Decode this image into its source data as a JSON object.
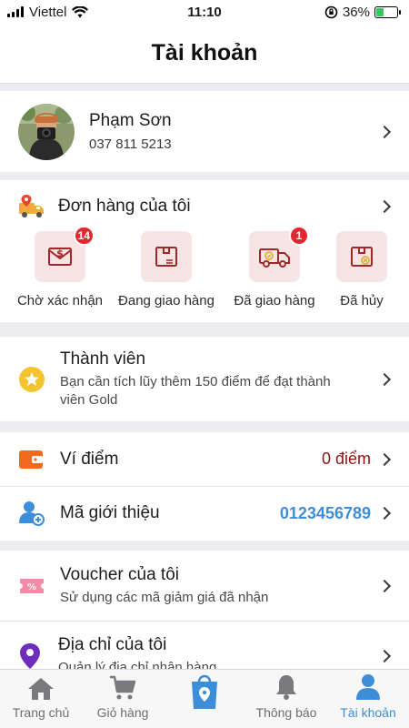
{
  "status_bar": {
    "carrier": "Viettel",
    "time": "11:10",
    "battery": "36%"
  },
  "header": {
    "title": "Tài khoản"
  },
  "profile": {
    "name": "Phạm Sơn",
    "phone": "037 811 5213"
  },
  "orders": {
    "title": "Đơn hàng của tôi",
    "items": [
      {
        "label": "Chờ xác nhận",
        "badge": "14",
        "icon": "envelope-money-icon"
      },
      {
        "label": "Đang giao hàng",
        "badge": "",
        "icon": "package-icon"
      },
      {
        "label": "Đã giao hàng",
        "badge": "1",
        "icon": "delivery-truck-icon"
      },
      {
        "label": "Đã hủy",
        "badge": "",
        "icon": "cancelled-box-icon"
      }
    ]
  },
  "membership": {
    "title": "Thành viên",
    "description": "Bạn cần tích lũy thêm 150 điểm để đạt thành viên Gold"
  },
  "wallet": {
    "title": "Ví điểm",
    "value": "0 điểm"
  },
  "referral": {
    "title": "Mã giới thiệu",
    "code": "0123456789"
  },
  "voucher": {
    "title": "Voucher của tôi",
    "description": "Sử dụng các mã giảm giá đã nhận"
  },
  "address": {
    "title": "Địa chỉ của tôi",
    "description": "Quản lý địa chỉ nhận hàng"
  },
  "tabbar": {
    "items": [
      {
        "label": "Trang chủ",
        "icon": "home-icon"
      },
      {
        "label": "Giỏ hàng",
        "icon": "cart-icon"
      },
      {
        "label": "",
        "icon": "shopping-bag-location-icon"
      },
      {
        "label": "Thông báo",
        "icon": "bell-icon"
      },
      {
        "label": "Tài khoản",
        "icon": "user-icon"
      }
    ],
    "active": "Tài khoản"
  },
  "colors": {
    "accent": "#3d8ed8",
    "badge": "#e0282f",
    "points": "#8b1414",
    "order_icon_bg": "#f7e5e5",
    "order_icon": "#a02828"
  }
}
